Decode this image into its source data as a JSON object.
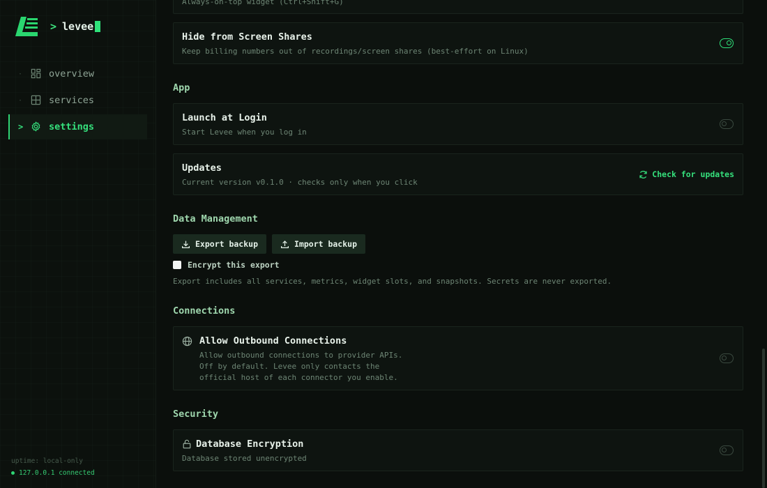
{
  "app": {
    "prompt": ">",
    "name": "levee"
  },
  "nav": [
    {
      "label": "overview",
      "icon": "overview-icon",
      "active": false
    },
    {
      "label": "services",
      "icon": "services-icon",
      "active": false
    },
    {
      "label": "settings",
      "icon": "gear-icon",
      "active": true
    }
  ],
  "sidebar_status": {
    "uptime": "uptime: local-only",
    "connection": "127.0.0.1 connected"
  },
  "top_card": {
    "desc": "Always-on-top widget (Ctrl+Shift+G)"
  },
  "hide_shares": {
    "title": "Hide from Screen Shares",
    "desc": "Keep billing numbers out of recordings/screen shares (best-effort on Linux)",
    "enabled": true
  },
  "sections": {
    "app": "App",
    "data": "Data Management",
    "connections": "Connections",
    "security": "Security"
  },
  "launch_login": {
    "title": "Launch at Login",
    "desc": "Start Levee when you log in",
    "enabled": false
  },
  "updates": {
    "title": "Updates",
    "desc": "Current version v0.1.0 · checks only when you click",
    "button": "Check for updates"
  },
  "data_mgmt": {
    "export_label": "Export backup",
    "import_label": "Import backup",
    "encrypt_label": "Encrypt this export",
    "encrypt_checked": false,
    "note": "Export includes all services, metrics, widget slots, and snapshots. Secrets are never exported."
  },
  "outbound": {
    "title": "Allow Outbound Connections",
    "desc_lines": [
      "Allow outbound connections to provider APIs.",
      "Off by default. Levee only contacts the",
      "official host of each connector you enable."
    ],
    "enabled": false
  },
  "db_encryption": {
    "title": "Database Encryption",
    "desc": "Database stored unencrypted",
    "enabled": false
  },
  "colors": {
    "accent": "#2fe27a",
    "background": "#0b0f0c",
    "card": "#0e1410"
  }
}
